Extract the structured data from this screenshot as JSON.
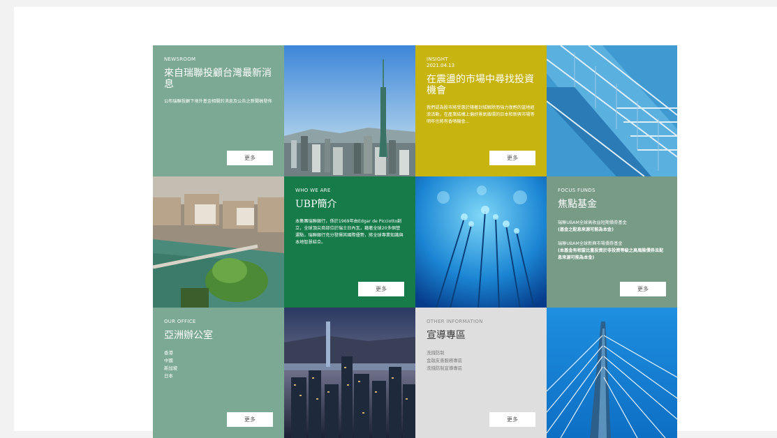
{
  "tiles": {
    "newsroom": {
      "eyebrow": "NEWSROOM",
      "title": "來自瑞聯投顧台灣最新消息",
      "desc": "公布瑞聯投顧下境外基金相關的消息及公告之新聞稿發佈",
      "more": "更多"
    },
    "insight": {
      "eyebrow": "INSIGHT",
      "date": "2021.04.13",
      "title": "在震盪的市場中尋找投資機會",
      "desc": "我們認為股市將受惠於隨著封城解除而強力復甦的當地經濟活動，在產業結構上偏好景氣循環的日本和新興市場等明年也將有香噴機會...",
      "more": "更多"
    },
    "who_we_are": {
      "eyebrow": "WHO WE ARE",
      "title": "UBP簡介",
      "desc": "本集團瑞聯銀行，係於1969年由Edgar de Picciotto創立，全球頂尖商部位於瑞士日內瓦，藉著全球20多個營運點，瑞聯銀行充分發揮其國際優勢，將全球專業知識與本地智慧結合。",
      "more": "更多"
    },
    "focus_funds": {
      "eyebrow": "FOCUS FUNDS",
      "title": "焦點基金",
      "fund1": "瑞聯UBAM全球高收益短期債券基金",
      "fund1_note": "(基金之配息來源可能為本金)",
      "fund2": "瑞聯UBAM全球新興市場債券基金",
      "fund2_note": "(本基金有相當比重投資於非投資等級之高風險債券且配息來源可能為本金)",
      "more": "更多"
    },
    "office": {
      "eyebrow": "OUR OFFICE",
      "title": "亞洲辦公室",
      "items": [
        "香港",
        "中國",
        "新加坡",
        "日本"
      ],
      "more": "更多"
    },
    "other": {
      "eyebrow": "OTHER INFORMATION",
      "title": "宣導專區",
      "items": [
        "洗錢防制",
        "金融友善服務專區",
        "洗錢防制宣導專區"
      ],
      "more": "更多"
    }
  },
  "images": {
    "taipei": "taipei-101-photo",
    "stairs": "glass-stairs-photo",
    "geneva": "geneva-city-photo",
    "fiber": "fiber-optics-photo",
    "hongkong": "hong-kong-night-photo",
    "bridge": "cable-bridge-photo"
  }
}
